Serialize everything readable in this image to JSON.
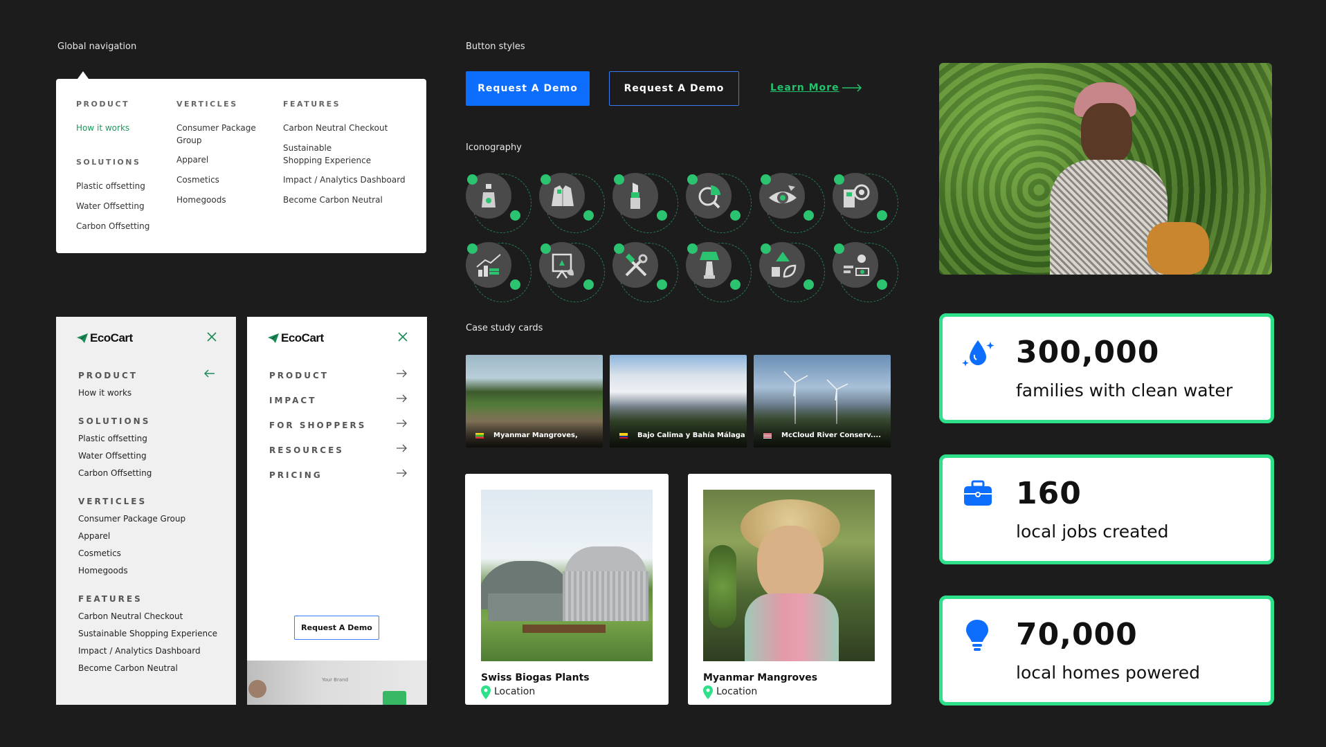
{
  "sections": {
    "global_nav": "Global navigation",
    "button_styles": "Button styles",
    "iconography": "Iconography",
    "case_study_cards": "Case study cards"
  },
  "mega_menu": {
    "product": {
      "heading": "PRODUCT",
      "items": [
        "How it works"
      ]
    },
    "solutions": {
      "heading": "SOLUTIONS",
      "items": [
        "Plastic offsetting",
        "Water Offsetting",
        "Carbon Offsetting"
      ]
    },
    "verticles": {
      "heading": "VERTICLES",
      "items": [
        "Consumer Package Group",
        "Apparel",
        "Cosmetics",
        "Homegoods"
      ]
    },
    "features": {
      "heading": "FEATURES",
      "items": [
        "Carbon Neutral Checkout",
        "Sustainable Shopping Experience",
        "Impact / Analytics Dashboard",
        "Become Carbon Neutral"
      ]
    }
  },
  "mobile_expanded": {
    "logo": "EcoCart",
    "groups": [
      {
        "heading": "PRODUCT",
        "items": [
          "How it works"
        ]
      },
      {
        "heading": "SOLUTIONS",
        "items": [
          "Plastic offsetting",
          "Water Offsetting",
          "Carbon Offsetting"
        ]
      },
      {
        "heading": "VERTICLES",
        "items": [
          "Consumer Package Group",
          "Apparel",
          "Cosmetics",
          "Homegoods"
        ]
      },
      {
        "heading": "FEATURES",
        "items": [
          "Carbon Neutral Checkout",
          "Sustainable Shopping Experience",
          "Impact / Analytics Dashboard",
          "Become Carbon Neutral"
        ]
      }
    ]
  },
  "mobile_menu": {
    "logo": "EcoCart",
    "items": [
      "PRODUCT",
      "IMPACT",
      "FOR SHOPPERS",
      "RESOURCES",
      "PRICING"
    ],
    "cta": "Request A Demo",
    "preview_text": "Your Brand"
  },
  "buttons": {
    "primary": "Request A Demo",
    "outline": "Request A Demo",
    "link": "Learn More"
  },
  "icons": [
    "spray-bottle-icon",
    "jacket-icon",
    "lipstick-icon",
    "chart-search-icon",
    "eye-icon",
    "recycle-machine-icon",
    "growth-chart-icon",
    "presentation-icon",
    "tools-icon",
    "lamp-icon",
    "recycle-leaf-icon",
    "people-stats-icon"
  ],
  "case_cards": [
    {
      "caption": "Myanmar Mangroves,",
      "flag": "myanmar-flag-icon"
    },
    {
      "caption": "Bajo Calima y Bahía Málaga",
      "flag": "colombia-flag-icon"
    },
    {
      "caption": "McCloud River Conserv....",
      "flag": "us-flag-icon"
    }
  ],
  "project_cards": [
    {
      "title": "Swiss Biogas Plants",
      "location": "Location"
    },
    {
      "title": "Myanmar Mangroves",
      "location": "Location"
    }
  ],
  "stats": [
    {
      "value": "300,000",
      "label": "families with clean water",
      "icon": "water-drop-icon"
    },
    {
      "value": "160",
      "label": "local jobs created",
      "icon": "briefcase-icon"
    },
    {
      "value": "70,000",
      "label": "local homes powered",
      "icon": "lightbulb-icon"
    }
  ],
  "colors": {
    "bg": "#1c1c1d",
    "accent_green": "#2fe08a",
    "primary_blue": "#0d6efd",
    "link_green": "#22c36b"
  }
}
